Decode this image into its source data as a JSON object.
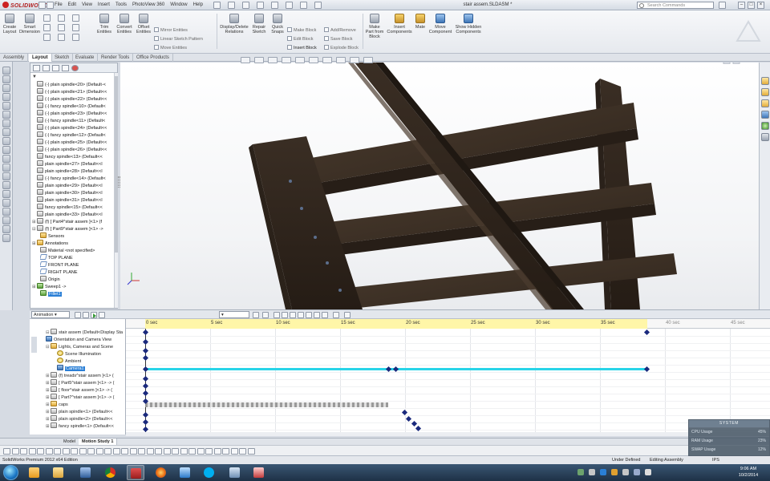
{
  "app": {
    "logo": "SOLIDWORKS",
    "document_title": "stair assem.SLDASM *",
    "edition": "SolidWorks Premium 2012 x64 Edition"
  },
  "menu": [
    "File",
    "Edit",
    "View",
    "Insert",
    "Tools",
    "PhotoView 360",
    "Window",
    "Help"
  ],
  "search": {
    "placeholder": "Search Commands"
  },
  "ribbon": {
    "create_layout": "Create Layout",
    "smart_dimension": "Smart Dimension",
    "trim_entities": "Trim Entities",
    "convert_entities": "Convert Entities",
    "offset_entities": "Offset Entities",
    "mirror_entities": "Mirror Entities",
    "linear_sketch_pattern": "Linear Sketch Pattern",
    "move_entities": "Move Entities",
    "display_delete_relations": "Display/Delete Relations",
    "repair_sketch": "Repair Sketch",
    "quick_snaps": "Quick Snaps",
    "make_block": "Make Block",
    "edit_block": "Edit Block",
    "insert_block": "Insert Block",
    "add_remove": "Add/Remove",
    "save_block": "Save Block",
    "explode_block": "Explode Block",
    "make_part_from_block": "Make Part from Block",
    "insert_components": "Insert Components",
    "mate": "Mate",
    "move_component": "Move Component",
    "show_hidden_components": "Show Hidden Components"
  },
  "command_tabs": [
    "Assembly",
    "Layout",
    "Sketch",
    "Evaluate",
    "Render Tools",
    "Office Products"
  ],
  "feature_tree": {
    "rows": [
      {
        "label": "(-) plain spindle<20> (Default-<",
        "icon": "part"
      },
      {
        "label": "(-) plain spindle<21> (Default<<",
        "icon": "part"
      },
      {
        "label": "(-) plain spindle<22> (Default<<",
        "icon": "part"
      },
      {
        "label": "(-) fancy spindle<10> (Default<",
        "icon": "part"
      },
      {
        "label": "(-) plain spindle<23> (Default<<",
        "icon": "part"
      },
      {
        "label": "(-) fancy spindle<11> (Default<",
        "icon": "part"
      },
      {
        "label": "(-) plain spindle<24> (Default<<",
        "icon": "part"
      },
      {
        "label": "(-) fancy spindle<12> (Default<",
        "icon": "part"
      },
      {
        "label": "(-) plain spindle<25> (Default<<",
        "icon": "part"
      },
      {
        "label": "(-) plain spindle<26> (Default<<",
        "icon": "part"
      },
      {
        "label": "fancy spindle<13> (Default<<",
        "icon": "part"
      },
      {
        "label": "plain spindle<27> (Default<<l",
        "icon": "part"
      },
      {
        "label": "plain spindle<28> (Default<<l",
        "icon": "part"
      },
      {
        "label": "(-) fancy spindle<14> (Default<",
        "icon": "part"
      },
      {
        "label": "plain spindle<29> (Default<<l",
        "icon": "part"
      },
      {
        "label": "plain spindle<30> (Default<<l",
        "icon": "part"
      },
      {
        "label": "plain spindle<31> (Default<<l",
        "icon": "part"
      },
      {
        "label": "fancy spindle<15> (Default<<",
        "icon": "part"
      },
      {
        "label": "plain spindle<33> (Default<<l",
        "icon": "part"
      },
      {
        "label": "(f) [ Part4^stair assem ]<1> (f",
        "icon": "part",
        "exp": "+"
      },
      {
        "label": "(f) [ Part9^stair assem ]<1> ->",
        "icon": "part",
        "exp": "-"
      },
      {
        "label": "Sensors",
        "icon": "fold"
      },
      {
        "label": "Annotations",
        "icon": "fold",
        "exp": "+"
      },
      {
        "label": "Material <not specified>",
        "icon": "part"
      },
      {
        "label": "TOP PLANE",
        "icon": "plane"
      },
      {
        "label": "FRONT PLANE",
        "icon": "plane"
      },
      {
        "label": "RIGHT PLANE",
        "icon": "plane"
      },
      {
        "label": "Origin",
        "icon": "part"
      },
      {
        "label": "Sweep1 ->",
        "icon": "green",
        "exp": "+"
      },
      {
        "label": "Fillet1",
        "icon": "green",
        "selected": true
      }
    ]
  },
  "motion_study": {
    "type": "Animation",
    "speed": "",
    "tree": [
      {
        "label": "stair assem (Default<Display Sta",
        "icon": "part",
        "exp": "-"
      },
      {
        "label": "Orientation and Camera View",
        "icon": "cam"
      },
      {
        "label": "Lights, Cameras and Scene",
        "icon": "fold",
        "exp": "-"
      },
      {
        "label": "Scene Illumination",
        "icon": "bulb",
        "indent": 1
      },
      {
        "label": "Ambient",
        "icon": "bulb",
        "indent": 1
      },
      {
        "label": "Camera1",
        "icon": "cam",
        "indent": 1,
        "selected": true
      },
      {
        "label": "(f) treads^stair assem ]<1> (",
        "icon": "part",
        "exp": "+"
      },
      {
        "label": "[ Part5^stair assem ]<1> -> (",
        "icon": "part",
        "exp": "+"
      },
      {
        "label": "[ floor^stair assem ]<1> -> (",
        "icon": "part",
        "exp": "+"
      },
      {
        "label": "[ Part7^stair assem ]<1> -> (",
        "icon": "part",
        "exp": "+"
      },
      {
        "label": "caps",
        "icon": "fold",
        "exp": "+"
      },
      {
        "label": "plain spindle<1> (Default<<",
        "icon": "part",
        "exp": "+"
      },
      {
        "label": "plain spindle<2> (Default<<",
        "icon": "part",
        "exp": "+"
      },
      {
        "label": "fancy spindle<1> (Default<<",
        "icon": "part",
        "exp": "+"
      }
    ],
    "ticks": [
      "0 sec",
      "5 sec",
      "10 sec",
      "15 sec",
      "20 sec",
      "25 sec",
      "30 sec",
      "35 sec",
      "40 sec",
      "45 sec"
    ],
    "tabs": [
      "Model",
      "Motion Study 1"
    ]
  },
  "status_bar": {
    "state": "Under Defined",
    "mode": "Editing Assembly",
    "units": "IPS"
  },
  "system_widget": {
    "title": "SYSTEM",
    "rows": [
      {
        "label": "CPU Usage",
        "value": "45%"
      },
      {
        "label": "RAM Usage",
        "value": "23%"
      },
      {
        "label": "SWAP Usage",
        "value": "12%"
      }
    ]
  },
  "clock": {
    "time": "9:06 AM",
    "date": "10/2/2014"
  },
  "colors": {
    "camera_track": "#29d4e8",
    "timeline_band": "#fff6a8",
    "wood": "#3a2e24",
    "selection": "#2a7fd6"
  }
}
